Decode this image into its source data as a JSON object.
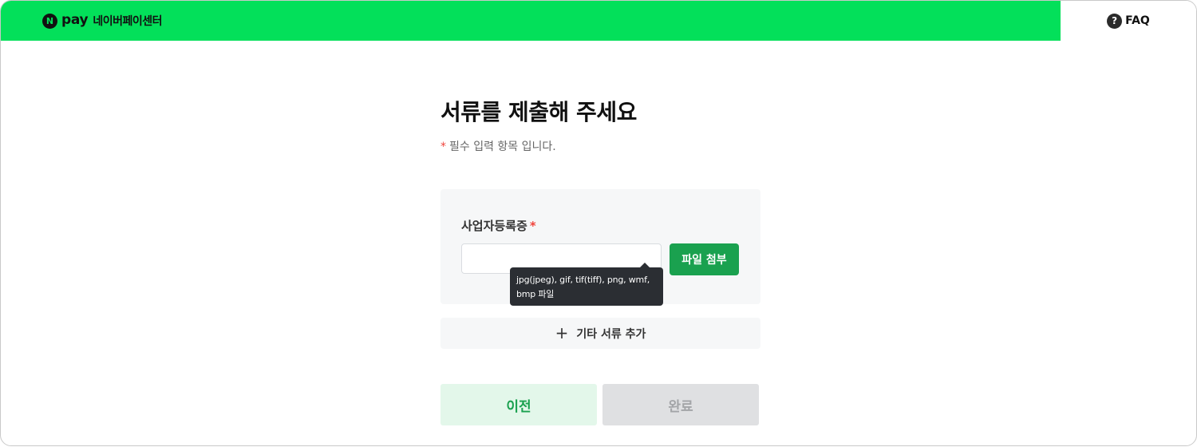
{
  "header": {
    "logo_badge": "N",
    "logo_text": "pay",
    "service_name": "네이버페이센터",
    "faq_icon": "?",
    "faq_label": "FAQ",
    "brand_color": "#03e05a"
  },
  "main": {
    "title": "서류를 제출해 주세요",
    "required_mark": "*",
    "required_note": "필수 입력 항목 입니다.",
    "document": {
      "label": "사업자등록증",
      "required_mark": "*",
      "file_value": "",
      "attach_label": "파일 첨부",
      "tooltip": "jpg(jpeg), gif, tif(tiff), png, wmf, bmp 파일"
    },
    "add_document": {
      "icon": "+",
      "label": "기타 서류 추가"
    }
  },
  "footer": {
    "prev_label": "이전",
    "done_label": "완료"
  }
}
